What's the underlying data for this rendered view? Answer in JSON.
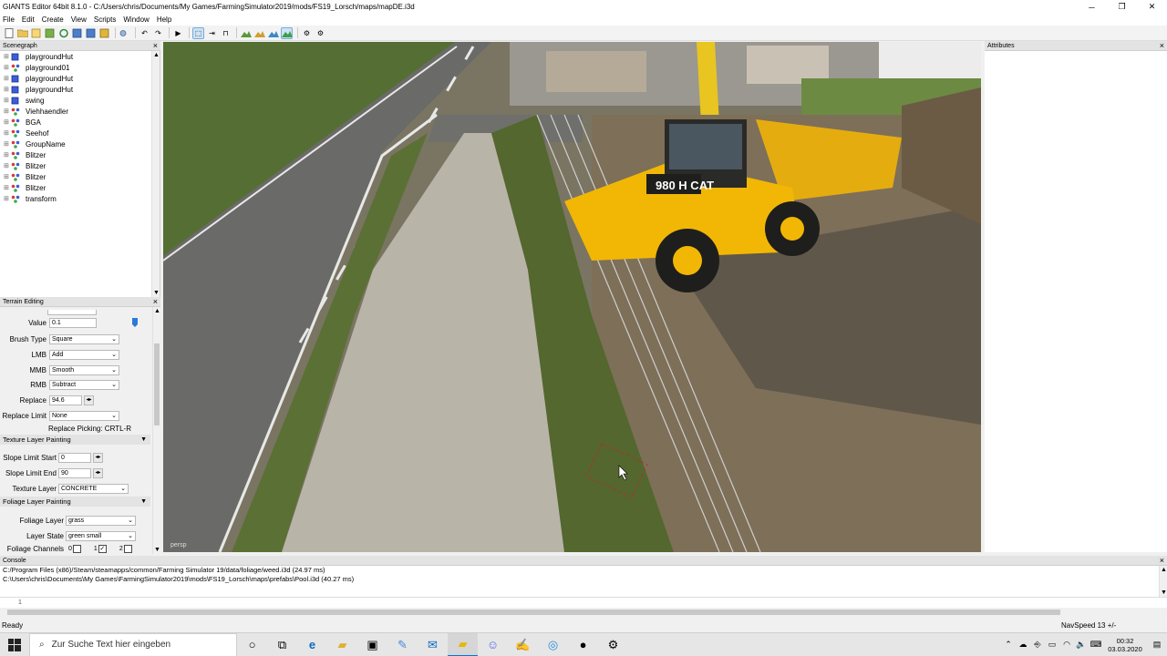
{
  "window": {
    "title": "GIANTS Editor 64bit 8.1.0 - C:/Users/chris/Documents/My Games/FarmingSimulator2019/mods/FS19_Lorsch/maps/mapDE.i3d",
    "minimize": "─",
    "maximize": "❐",
    "close": "✕"
  },
  "menu": [
    "File",
    "Edit",
    "Create",
    "View",
    "Scripts",
    "Window",
    "Help"
  ],
  "scenegraph": {
    "title": "Scenegraph",
    "items": [
      {
        "label": "playgroundHut",
        "type": "object"
      },
      {
        "label": "playground01",
        "type": "group"
      },
      {
        "label": "playgroundHut",
        "type": "object"
      },
      {
        "label": "playgroundHut",
        "type": "object"
      },
      {
        "label": "swing",
        "type": "object"
      },
      {
        "label": "Viehhaendler",
        "type": "group"
      },
      {
        "label": "BGA",
        "type": "group"
      },
      {
        "label": "Seehof",
        "type": "group"
      },
      {
        "label": "GroupName",
        "type": "group"
      },
      {
        "label": "Blitzer",
        "type": "group"
      },
      {
        "label": "Blitzer",
        "type": "group"
      },
      {
        "label": "Blitzer",
        "type": "group"
      },
      {
        "label": "Blitzer",
        "type": "group"
      },
      {
        "label": "transform",
        "type": "group"
      }
    ]
  },
  "terrain": {
    "title": "Terrain Editing",
    "value_label": "Value",
    "value": "0.1",
    "brush_type_label": "Brush Type",
    "brush_type": "Square",
    "lmb_label": "LMB",
    "lmb": "Add",
    "mmb_label": "MMB",
    "mmb": "Smooth",
    "rmb_label": "RMB",
    "rmb": "Subtract",
    "replace_label": "Replace",
    "replace": "94.6",
    "replace_limit_label": "Replace Limit",
    "replace_limit": "None",
    "replace_picking": "Replace Picking: CRTL-R",
    "texture_section": "Texture Layer Painting",
    "slope_start_label": "Slope Limit Start",
    "slope_start": "0",
    "slope_end_label": "Slope Limit End",
    "slope_end": "90",
    "texture_layer_label": "Texture Layer",
    "texture_layer": "CONCRETE",
    "foliage_section": "Foliage Layer Painting",
    "foliage_layer_label": "Foliage Layer",
    "foliage_layer": "grass",
    "layer_state_label": "Layer State",
    "layer_state": "green small",
    "foliage_channels_label": "Foliage Channels",
    "channel_0": "0",
    "channel_1": "1",
    "channel_2": "2"
  },
  "viewport": {
    "camera_label": "persp",
    "vehicle_badge": "980 H CAT"
  },
  "attributes": {
    "title": "Attributes"
  },
  "console": {
    "title": "Console",
    "lines": [
      "C:/Program Files (x86)/Steam/steamapps/common/Farming Simulator 19/data/foliage/weed.i3d (24.97 ms)",
      "C:\\Users\\chris\\Documents\\My Games\\FarmingSimulator2019\\mods\\FS19_Lorsch\\maps\\prefabs\\Pool.i3d (40.27 ms)"
    ],
    "line_number": "1"
  },
  "status": {
    "left": "Ready",
    "right": "NavSpeed 13 +/-"
  },
  "taskbar": {
    "search_placeholder": "Zur Suche Text hier eingeben",
    "time": "00:32",
    "date": "03.03.2020"
  },
  "colors": {
    "accent": "#0078d7",
    "loader_yellow": "#f2b705",
    "grass": "#5d7a35"
  }
}
